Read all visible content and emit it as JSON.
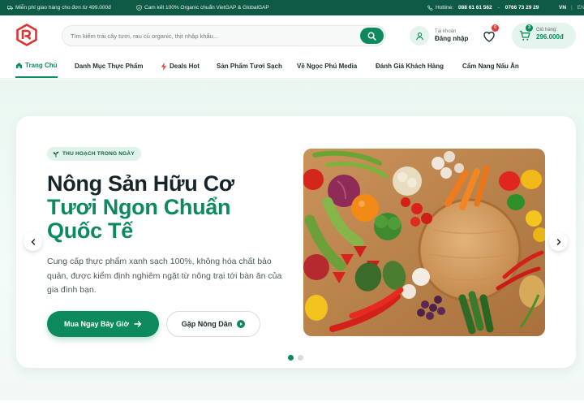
{
  "topbar": {
    "shipping": "Miễn phí giao hàng cho đơn từ 499.000đ",
    "organic": "Cam kết 100% Organic chuẩn VietGAP & GlobalGAP",
    "hotline_label": "Hotline:",
    "hotline_1": "088 61 61 562",
    "separator": "-",
    "hotline_2": "0766 73 29 29",
    "lang_vn": "VN",
    "lang_divider": "|",
    "lang_en": "EN"
  },
  "header": {
    "search_placeholder": "Tìm kiếm trái cây tươi, rau củ organic, thịt nhập khẩu...",
    "account_label": "Tài khoản",
    "account_action": "Đăng nhập",
    "wishlist_count": "0",
    "cart_count": "3",
    "cart_label": "Giỏ hàng:",
    "cart_total": "296.000đ"
  },
  "nav": {
    "items": [
      {
        "label": "Trang Chủ",
        "active": true
      },
      {
        "label": "Danh Mục Thực Phẩm"
      },
      {
        "label": "Deals Hot"
      },
      {
        "label": "Sản Phẩm Tươi Sạch"
      },
      {
        "label": "Về Ngọc Phú Media"
      },
      {
        "label": "Đánh Giá Khách Hàng"
      },
      {
        "label": "Cẩm Nang Nấu Ăn"
      }
    ]
  },
  "hero": {
    "tag": "THU HOẠCH TRONG NGÀY",
    "title_line1": "Nông Sản Hữu Cơ",
    "title_line2": "Tươi Ngon Chuẩn",
    "title_line3": "Quốc Tế",
    "description": "Cung cấp thực phẩm xanh sạch 100%, không hóa chất bảo quản, được kiểm định nghiêm ngặt từ nông trại tới bàn ăn của gia đình bạn.",
    "primary_button": "Mua Ngay Bây Giờ",
    "secondary_button": "Gặp Nông Dân",
    "slide_count": 2,
    "active_slide": 1
  },
  "colors": {
    "brand": "#0c8a5e",
    "topbar": "#0f5a45",
    "heading": "#16252a",
    "badge": "#e23b3b"
  },
  "icons": [
    "leaf-icon",
    "shield-check-icon",
    "phone-icon",
    "logo-icon",
    "search-icon",
    "user-icon",
    "heart-icon",
    "cart-icon",
    "home-icon",
    "lightning-icon",
    "sprout-icon",
    "arrow-right-icon",
    "play-circle-icon",
    "chevron-left-icon",
    "chevron-right-icon"
  ]
}
